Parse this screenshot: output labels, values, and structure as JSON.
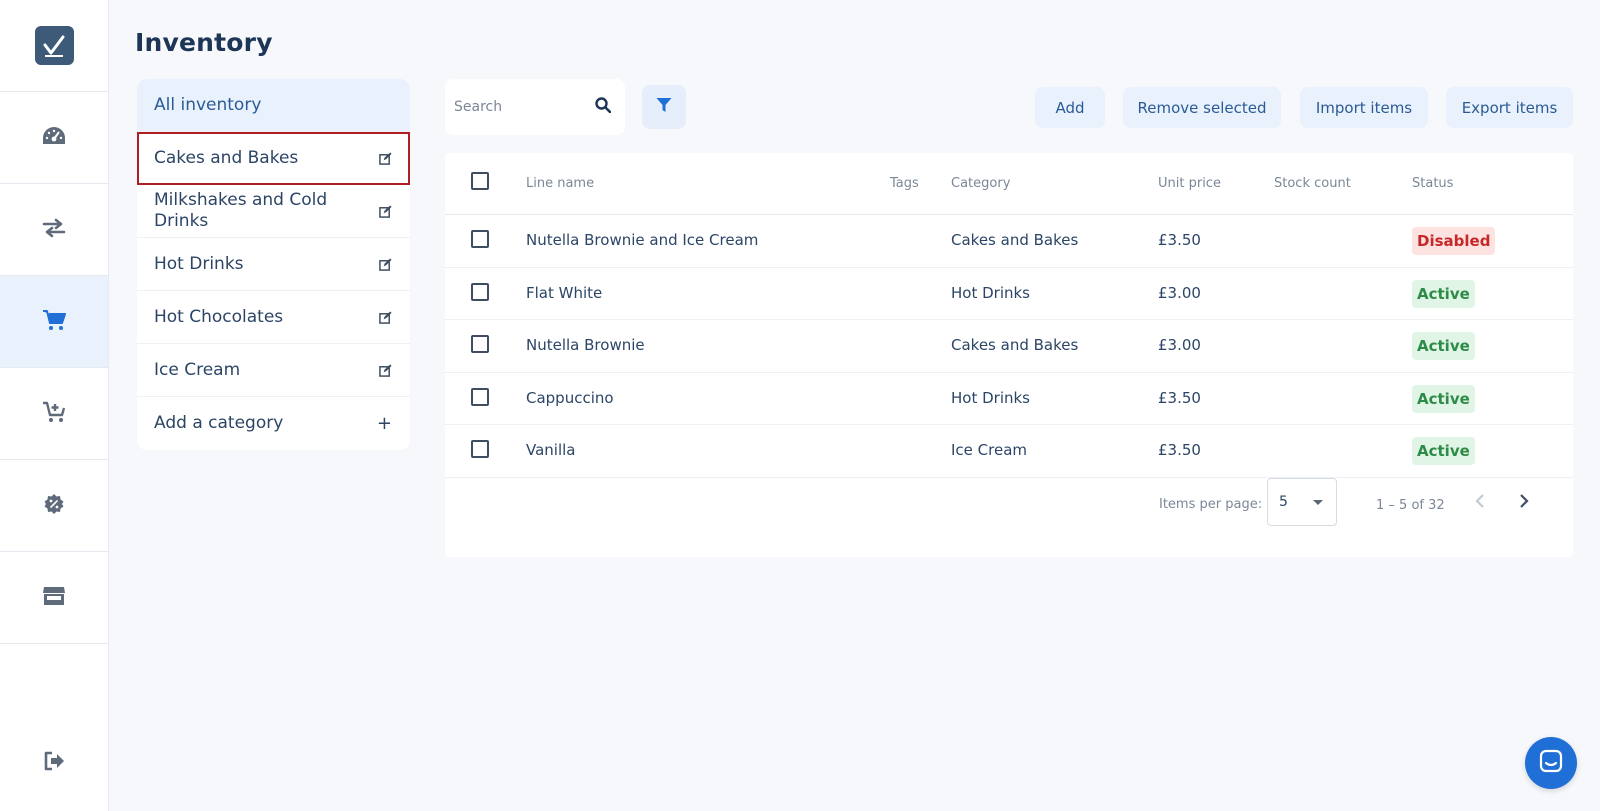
{
  "app": {
    "title": "Inventory"
  },
  "rail": {
    "items": [
      {
        "name": "dashboard-icon",
        "active": false
      },
      {
        "name": "transfer-arrows-icon",
        "active": false
      },
      {
        "name": "cart-icon",
        "active": true
      },
      {
        "name": "cart-add-icon",
        "active": false
      },
      {
        "name": "discount-badge-icon",
        "active": false
      },
      {
        "name": "store-icon",
        "active": false
      }
    ],
    "bottom": {
      "name": "logout-icon"
    }
  },
  "categories": {
    "all_label": "All inventory",
    "items": [
      {
        "label": "Cakes and Bakes",
        "selected": true
      },
      {
        "label": "Milkshakes and Cold Drinks",
        "selected": false
      },
      {
        "label": "Hot Drinks",
        "selected": false
      },
      {
        "label": "Hot Chocolates",
        "selected": false
      },
      {
        "label": "Ice Cream",
        "selected": false
      }
    ],
    "add_label": "Add a category",
    "add_symbol": "+"
  },
  "toolbar": {
    "search_placeholder": "Search",
    "add_label": "Add",
    "remove_label": "Remove selected",
    "import_label": "Import items",
    "export_label": "Export items"
  },
  "table": {
    "columns": {
      "line_name": "Line name",
      "tags": "Tags",
      "category": "Category",
      "unit_price": "Unit price",
      "stock_count": "Stock count",
      "status": "Status"
    },
    "rows": [
      {
        "name": "Nutella Brownie and Ice Cream",
        "tags": "",
        "category": "Cakes and Bakes",
        "price": "£3.50",
        "stock": "",
        "status": "Disabled"
      },
      {
        "name": "Flat White",
        "tags": "",
        "category": "Hot Drinks",
        "price": "£3.00",
        "stock": "",
        "status": "Active"
      },
      {
        "name": "Nutella Brownie",
        "tags": "",
        "category": "Cakes and Bakes",
        "price": "£3.00",
        "stock": "",
        "status": "Active"
      },
      {
        "name": "Cappuccino",
        "tags": "",
        "category": "Hot Drinks",
        "price": "£3.50",
        "stock": "",
        "status": "Active"
      },
      {
        "name": "Vanilla",
        "tags": "",
        "category": "Ice Cream",
        "price": "£3.50",
        "stock": "",
        "status": "Active"
      }
    ]
  },
  "pagination": {
    "items_per_page_label": "Items per page:",
    "items_per_page_value": "5",
    "range_label": "1 – 5 of 32"
  },
  "colors": {
    "accent": "#1f6fd6",
    "status_disabled": "#c62828",
    "status_active": "#2e8b47",
    "selection_outline": "#b01e24"
  }
}
